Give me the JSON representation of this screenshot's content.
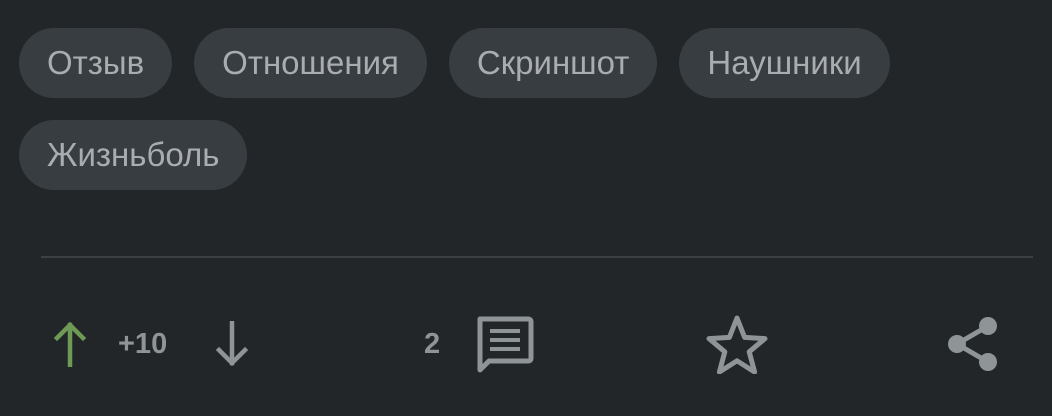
{
  "tags": [
    "Отзыв",
    "Отношения",
    "Скриншот",
    "Наушники",
    "Жизньболь"
  ],
  "rating": {
    "score": "+10",
    "upvote_icon": "arrow-up-icon",
    "downvote_icon": "arrow-down-icon",
    "upvote_color": "#6e9a56"
  },
  "comments": {
    "count": "2",
    "icon": "comment-icon"
  },
  "favorite": {
    "icon": "star-outline-icon"
  },
  "share": {
    "icon": "share-icon"
  },
  "colors": {
    "background": "#222629",
    "tag_background": "#383d41",
    "tag_text": "#a9adb0",
    "icon_gray": "#8f9497"
  }
}
